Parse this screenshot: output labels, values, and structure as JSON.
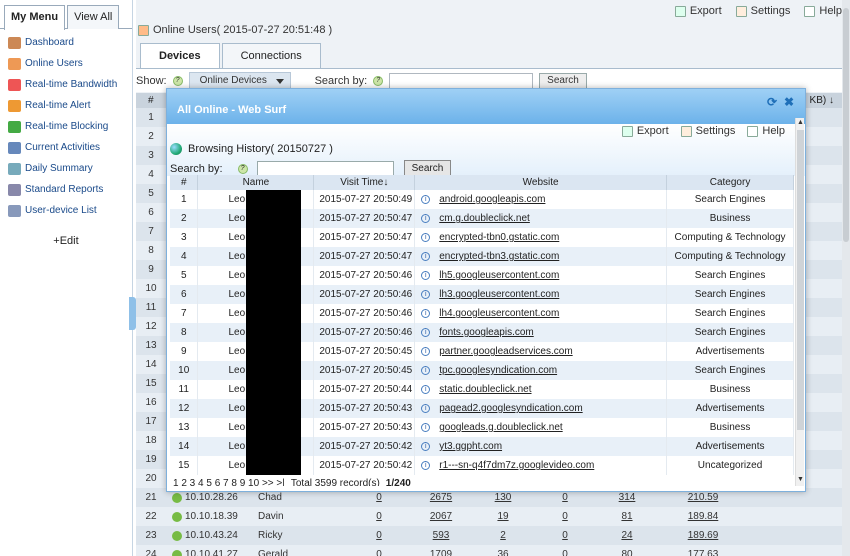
{
  "left": {
    "tabs": [
      "My Menu",
      "View All"
    ],
    "menu": [
      {
        "label": "Dashboard",
        "icon": "house-icon",
        "color": "#c85"
      },
      {
        "label": "Online Users",
        "icon": "users-icon",
        "color": "#e95"
      },
      {
        "label": "Real-time Bandwidth",
        "icon": "gauge-icon",
        "color": "#e55"
      },
      {
        "label": "Real-time Alert",
        "icon": "alert-icon",
        "color": "#e93"
      },
      {
        "label": "Real-time Blocking",
        "icon": "globe-block-icon",
        "color": "#4a4"
      },
      {
        "label": "Current Activities",
        "icon": "bar-chart-icon",
        "color": "#68b"
      },
      {
        "label": "Daily Summary",
        "icon": "pencil-icon",
        "color": "#7ab"
      },
      {
        "label": "Standard Reports",
        "icon": "report-icon",
        "color": "#88a"
      },
      {
        "label": "User-device List",
        "icon": "list-icon",
        "color": "#89b"
      }
    ],
    "edit": "+Edit"
  },
  "top": {
    "export": "Export",
    "settings": "Settings",
    "help": "Help"
  },
  "main": {
    "crumb": "Online Users( 2015-07-27 20:51:48 )",
    "tabs": [
      "Devices",
      "Connections"
    ],
    "show_label": "Show:",
    "show_value": "Online Devices",
    "search_label": "Search by:",
    "search_button": "Search",
    "col_first": "#",
    "col_last": "KB) ↓",
    "rows": [
      {
        "n": "1"
      },
      {
        "n": "2"
      },
      {
        "n": "3"
      },
      {
        "n": "4"
      },
      {
        "n": "5"
      },
      {
        "n": "6"
      },
      {
        "n": "7"
      },
      {
        "n": "8"
      },
      {
        "n": "9"
      },
      {
        "n": "10"
      },
      {
        "n": "11"
      },
      {
        "n": "12"
      },
      {
        "n": "13"
      },
      {
        "n": "14"
      },
      {
        "n": "15"
      },
      {
        "n": "16"
      },
      {
        "n": "17"
      },
      {
        "n": "18"
      },
      {
        "n": "19"
      },
      {
        "n": "20"
      },
      {
        "n": "21",
        "ip": "10.10.28.26",
        "name": "Chad",
        "a": "0",
        "b": "2675",
        "c": "130",
        "d": "0",
        "e": "314",
        "f": "210.59"
      },
      {
        "n": "22",
        "ip": "10.10.18.39",
        "name": "Davin",
        "a": "0",
        "b": "2067",
        "c": "19",
        "d": "0",
        "e": "81",
        "f": "189.84"
      },
      {
        "n": "23",
        "ip": "10.10.43.24",
        "name": "Ricky",
        "a": "0",
        "b": "593",
        "c": "2",
        "d": "0",
        "e": "24",
        "f": "189.69"
      },
      {
        "n": "24",
        "ip": "10.10.41.27",
        "name": "Gerald",
        "a": "0",
        "b": "1709",
        "c": "36",
        "d": "0",
        "e": "80",
        "f": "177.63"
      }
    ]
  },
  "dialog": {
    "title": "All Online - Web Surf",
    "export": "Export",
    "settings": "Settings",
    "help": "Help",
    "history": "Browsing History( 20150727 )",
    "search_label": "Search by:",
    "search_button": "Search",
    "columns": [
      "#",
      "Name",
      "Visit Time↓",
      "Website",
      "Category"
    ],
    "rows": [
      {
        "n": "1",
        "name": "Leo",
        "time": "2015-07-27 20:50:49",
        "site": "android.googleapis.com",
        "cat": "Search Engines"
      },
      {
        "n": "2",
        "name": "Leo",
        "time": "2015-07-27 20:50:47",
        "site": "cm.g.doubleclick.net",
        "cat": "Business"
      },
      {
        "n": "3",
        "name": "Leo",
        "time": "2015-07-27 20:50:47",
        "site": "encrypted-tbn0.gstatic.com",
        "cat": "Computing & Technology"
      },
      {
        "n": "4",
        "name": "Leo",
        "time": "2015-07-27 20:50:47",
        "site": "encrypted-tbn3.gstatic.com",
        "cat": "Computing & Technology"
      },
      {
        "n": "5",
        "name": "Leo",
        "time": "2015-07-27 20:50:46",
        "site": "lh5.googleusercontent.com",
        "cat": "Search Engines"
      },
      {
        "n": "6",
        "name": "Leo",
        "time": "2015-07-27 20:50:46",
        "site": "lh3.googleusercontent.com",
        "cat": "Search Engines"
      },
      {
        "n": "7",
        "name": "Leo",
        "time": "2015-07-27 20:50:46",
        "site": "lh4.googleusercontent.com",
        "cat": "Search Engines"
      },
      {
        "n": "8",
        "name": "Leo",
        "time": "2015-07-27 20:50:46",
        "site": "fonts.googleapis.com",
        "cat": "Search Engines"
      },
      {
        "n": "9",
        "name": "Leo",
        "time": "2015-07-27 20:50:45",
        "site": "partner.googleadservices.com",
        "cat": "Advertisements"
      },
      {
        "n": "10",
        "name": "Leo",
        "time": "2015-07-27 20:50:45",
        "site": "tpc.googlesyndication.com",
        "cat": "Search Engines"
      },
      {
        "n": "11",
        "name": "Leo",
        "time": "2015-07-27 20:50:44",
        "site": "static.doubleclick.net",
        "cat": "Business"
      },
      {
        "n": "12",
        "name": "Leo",
        "time": "2015-07-27 20:50:43",
        "site": "pagead2.googlesyndication.com",
        "cat": "Advertisements"
      },
      {
        "n": "13",
        "name": "Leo",
        "time": "2015-07-27 20:50:43",
        "site": "googleads.g.doubleclick.net",
        "cat": "Business"
      },
      {
        "n": "14",
        "name": "Leo",
        "time": "2015-07-27 20:50:42",
        "site": "yt3.ggpht.com",
        "cat": "Advertisements"
      },
      {
        "n": "15",
        "name": "Leo",
        "time": "2015-07-27 20:50:42",
        "site": "r1---sn-q4f7dm7z.googlevideo.com",
        "cat": "Uncategorized"
      }
    ],
    "pager": {
      "pages": "1 2 3 4 5 6 7 8 9 10 >> >|",
      "total": "Total 3599 record(s)",
      "page": "1/240"
    }
  }
}
